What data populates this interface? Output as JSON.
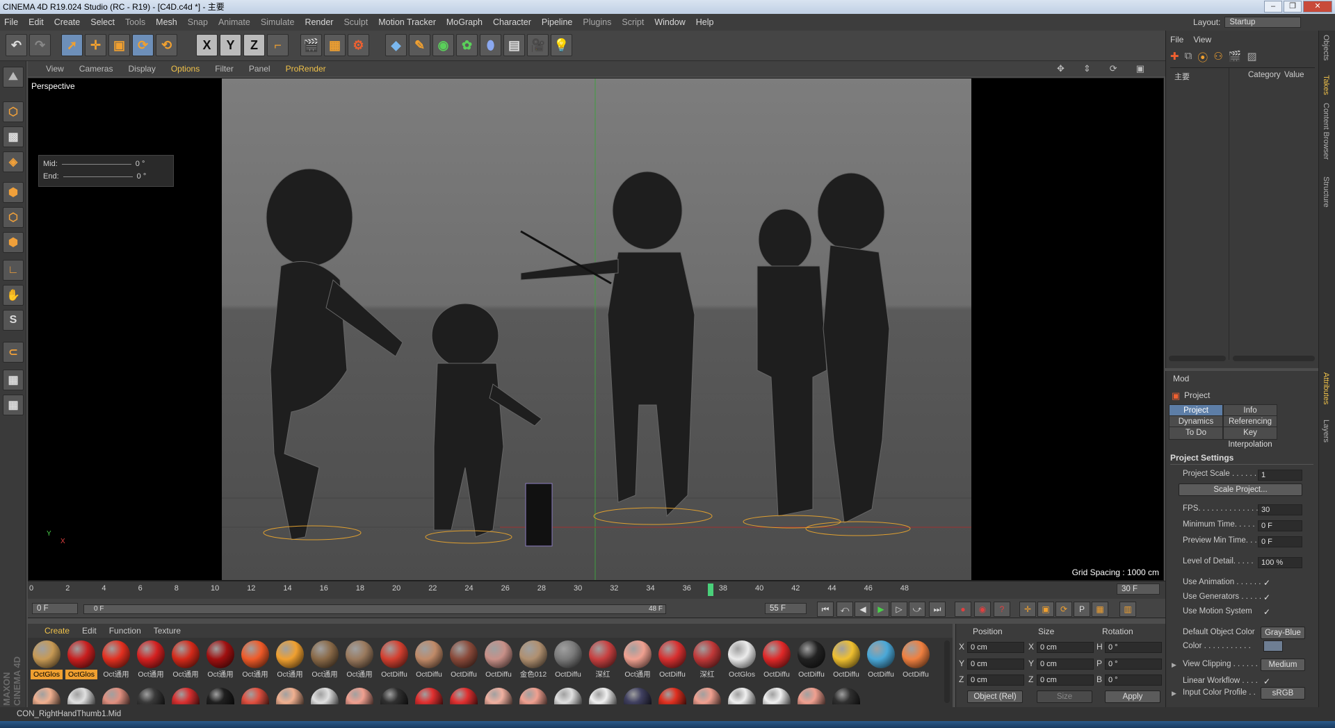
{
  "window": {
    "title": "CINEMA 4D R19.024 Studio (RC - R19) - [C4D.c4d *] - 主要",
    "controls": [
      "–",
      "❐",
      "✕"
    ]
  },
  "menu": [
    "File",
    "Edit",
    "Create",
    "Select",
    "Tools",
    "Mesh",
    "Snap",
    "Animate",
    "Simulate",
    "Render",
    "Sculpt",
    "Motion Tracker",
    "MoGraph",
    "Character",
    "Pipeline",
    "Plugins",
    "Script",
    "Window",
    "Help"
  ],
  "layout": {
    "label": "Layout:",
    "value": "Startup"
  },
  "toolbar": {
    "axis": [
      "X",
      "Y",
      "Z"
    ]
  },
  "viewport": {
    "menu": [
      "View",
      "Cameras",
      "Display",
      "Options",
      "Filter",
      "Panel",
      "ProRender"
    ],
    "label": "Perspective",
    "grid_spacing": "Grid Spacing : 1000 cm",
    "mid_label": "Mid:",
    "end_label": "End:",
    "mid_value": "0 °",
    "end_value": "0 °"
  },
  "timeline": {
    "ticks": [
      "0",
      "2",
      "4",
      "6",
      "8",
      "10",
      "12",
      "14",
      "16",
      "18",
      "20",
      "22",
      "24",
      "26",
      "28",
      "30",
      "32",
      "34",
      "36",
      "38",
      "40",
      "42",
      "44",
      "46",
      "48"
    ],
    "current": "30 F",
    "start": "0 F",
    "range_start": "0 F",
    "range_end": "48 F",
    "end": "55 F"
  },
  "materials": {
    "menu": [
      "Create",
      "Edit",
      "Function",
      "Texture"
    ],
    "row1": [
      {
        "label": "OctGlos",
        "color": "#c79a55"
      },
      {
        "label": "OctGlos",
        "color": "#c91f1f"
      },
      {
        "label": "Oct通用",
        "color": "#e33020"
      },
      {
        "label": "Oct通用",
        "color": "#d42020"
      },
      {
        "label": "Oct通用",
        "color": "#d42a1a"
      },
      {
        "label": "Oct通用",
        "color": "#a01010"
      },
      {
        "label": "Oct通用",
        "color": "#f05a28"
      },
      {
        "label": "Oct通用",
        "color": "#f0a030"
      },
      {
        "label": "Oct通用",
        "color": "#8a6a48"
      },
      {
        "label": "Oct通用",
        "color": "#9a7a5e"
      },
      {
        "label": "OctDiffu",
        "color": "#d44030"
      },
      {
        "label": "OctDiffu",
        "color": "#c08a68"
      },
      {
        "label": "OctDiffu",
        "color": "#8a4a3a"
      },
      {
        "label": "OctDiffu",
        "color": "#c89088"
      },
      {
        "label": "金色012",
        "color": "#b09070"
      },
      {
        "label": "OctDiffu",
        "color": "#7a7a7a"
      },
      {
        "label": "深红",
        "color": "#c84040"
      },
      {
        "label": "Oct通用",
        "color": "#f0a090"
      },
      {
        "label": "OctDiffu",
        "color": "#d83030"
      },
      {
        "label": "深红",
        "color": "#c03838"
      },
      {
        "label": "OctGlos",
        "color": "#ececec"
      },
      {
        "label": "OctDiffu",
        "color": "#e02828"
      },
      {
        "label": "OctDiffu",
        "color": "#222222"
      },
      {
        "label": "OctDiffu",
        "color": "#f0c030"
      },
      {
        "label": "OctDiffu",
        "color": "#4aa8d8"
      },
      {
        "label": "OctDiffu",
        "color": "#f08040"
      }
    ],
    "row2": [
      "#f0b090",
      "#e0e0e0",
      "#e09080",
      "#3a3a3a",
      "#d83030",
      "#202020",
      "#e05040",
      "#f0b090",
      "#e0e0e0",
      "#f0a090",
      "#303030",
      "#e03030",
      "#e03030",
      "#f0b0a0",
      "#f0a090",
      "#e0e0e0",
      "#f0f0f0",
      "#404060",
      "#e03020",
      "#f0a090",
      "#f0f0f0",
      "#f0f0f0",
      "#f0a090",
      "#303030"
    ]
  },
  "coords": {
    "headers": [
      "Position",
      "Size",
      "Rotation"
    ],
    "pos": [
      {
        "axis": "X",
        "value": "0 cm"
      },
      {
        "axis": "Y",
        "value": "0 cm"
      },
      {
        "axis": "Z",
        "value": "0 cm"
      }
    ],
    "size": [
      {
        "axis": "X",
        "value": "0 cm"
      },
      {
        "axis": "Y",
        "value": "0 cm"
      },
      {
        "axis": "Z",
        "value": "0 cm"
      }
    ],
    "rot": [
      {
        "axis": "H",
        "value": "0 °"
      },
      {
        "axis": "P",
        "value": "0 °"
      },
      {
        "axis": "B",
        "value": "0 °"
      }
    ],
    "mode": "Object (Rel)",
    "size_mode": "Size",
    "apply": "Apply"
  },
  "objects": {
    "menu": [
      "File",
      "View"
    ],
    "root": "主要",
    "col_category": "Category",
    "col_value": "Value"
  },
  "attributes": {
    "mode": "Mod",
    "title": "Project",
    "tabs": [
      {
        "label": "Project Settings",
        "selected": true
      },
      {
        "label": "Info",
        "selected": false
      },
      {
        "label": "Dynamics",
        "selected": false
      },
      {
        "label": "Referencing",
        "selected": false
      },
      {
        "label": "To Do",
        "selected": false
      },
      {
        "label": "Key Interpolation",
        "selected": false
      }
    ],
    "section": "Project Settings",
    "scale_label": "Project Scale . . . . . .",
    "scale_value": "1",
    "scale_btn": "Scale Project...",
    "fps_label": "FPS. . . . . . . . . . . . . .",
    "fps_value": "30",
    "min_label": "Minimum Time. . . . .",
    "min_value": "0 F",
    "prev_label": "Preview Min Time. . .",
    "prev_value": "0 F",
    "lod_label": "Level of Detail. . . . .",
    "lod_value": "100 %",
    "use_anim": "Use Animation . . . . . .",
    "use_gen": "Use Generators . . . . .",
    "use_motion": "Use Motion System",
    "def_color_label": "Default Object Color",
    "def_color_value": "Gray-Blue",
    "color_label": "Color . . . . . . . . . . .",
    "clip_label": "View Clipping . . . . . .",
    "clip_value": "Medium",
    "linear_label": "Linear Workflow . . . .",
    "input_label": "Input Color Profile . .",
    "input_value": "sRGB"
  },
  "right_tabs": [
    "Objects",
    "Takes",
    "Content Browser",
    "Structure",
    "Attributes",
    "Layers"
  ],
  "status": "CON_RightHandThumb1.Mid",
  "brand": "MAXON CINEMA 4D",
  "colors": {
    "accent": "#f0c24a",
    "selection": "#5d7ea7",
    "rig": "#f0a030"
  }
}
